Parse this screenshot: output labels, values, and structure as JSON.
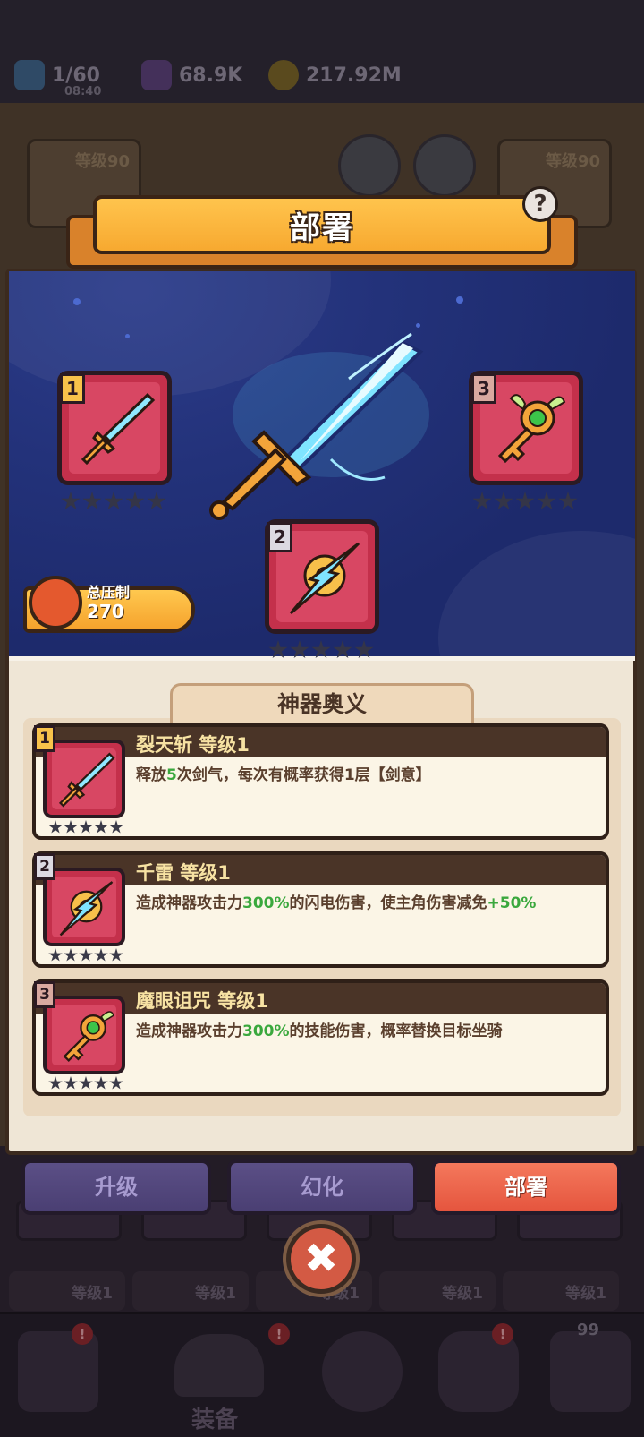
{
  "top_bar": {
    "energy": "1/60",
    "energy_timer": "08:40",
    "gems": "68.9K",
    "gold": "217.92M"
  },
  "background": {
    "slot_level_left": "等级90",
    "slot_level_right": "等级90",
    "grid_levels": [
      "等级1",
      "等级1",
      "等级1",
      "等级1",
      "等级1"
    ],
    "nav_label": "装备",
    "nav_badge": "!",
    "chest_count": "99"
  },
  "dialog": {
    "title": "部署",
    "help": "?",
    "slots": [
      {
        "num": "1",
        "item": "sword-icon",
        "stars": 5
      },
      {
        "num": "2",
        "item": "lightning-icon",
        "stars": 5
      },
      {
        "num": "3",
        "item": "key-icon",
        "stars": 5
      }
    ],
    "power": {
      "label": "总压制",
      "value": "270"
    },
    "section_title": "神器奥义",
    "skills": [
      {
        "num": "1",
        "title": "裂天斩 等级1",
        "desc_parts": [
          "释放",
          "5",
          "次剑气，每次有概率获得1层【剑意】"
        ]
      },
      {
        "num": "2",
        "title": "千雷 等级1",
        "desc_parts": [
          "造成神器攻击力",
          "300%",
          "的闪电伤害，使主角伤害减免",
          "+50%"
        ]
      },
      {
        "num": "3",
        "title": "魔眼诅咒 等级1",
        "desc_parts": [
          "造成神器攻击力",
          "300%",
          "的技能伤害，概率替换目标坐骑"
        ]
      }
    ],
    "buttons": {
      "upgrade": "升级",
      "transform": "幻化",
      "deploy": "部署"
    },
    "close": "✖"
  },
  "colors": {
    "accent_orange": "#f7a930",
    "card_red": "#c4304b",
    "highlight_green": "#3aa83d",
    "deploy_button": "#e5553e",
    "purple_button": "#4a3f73"
  }
}
